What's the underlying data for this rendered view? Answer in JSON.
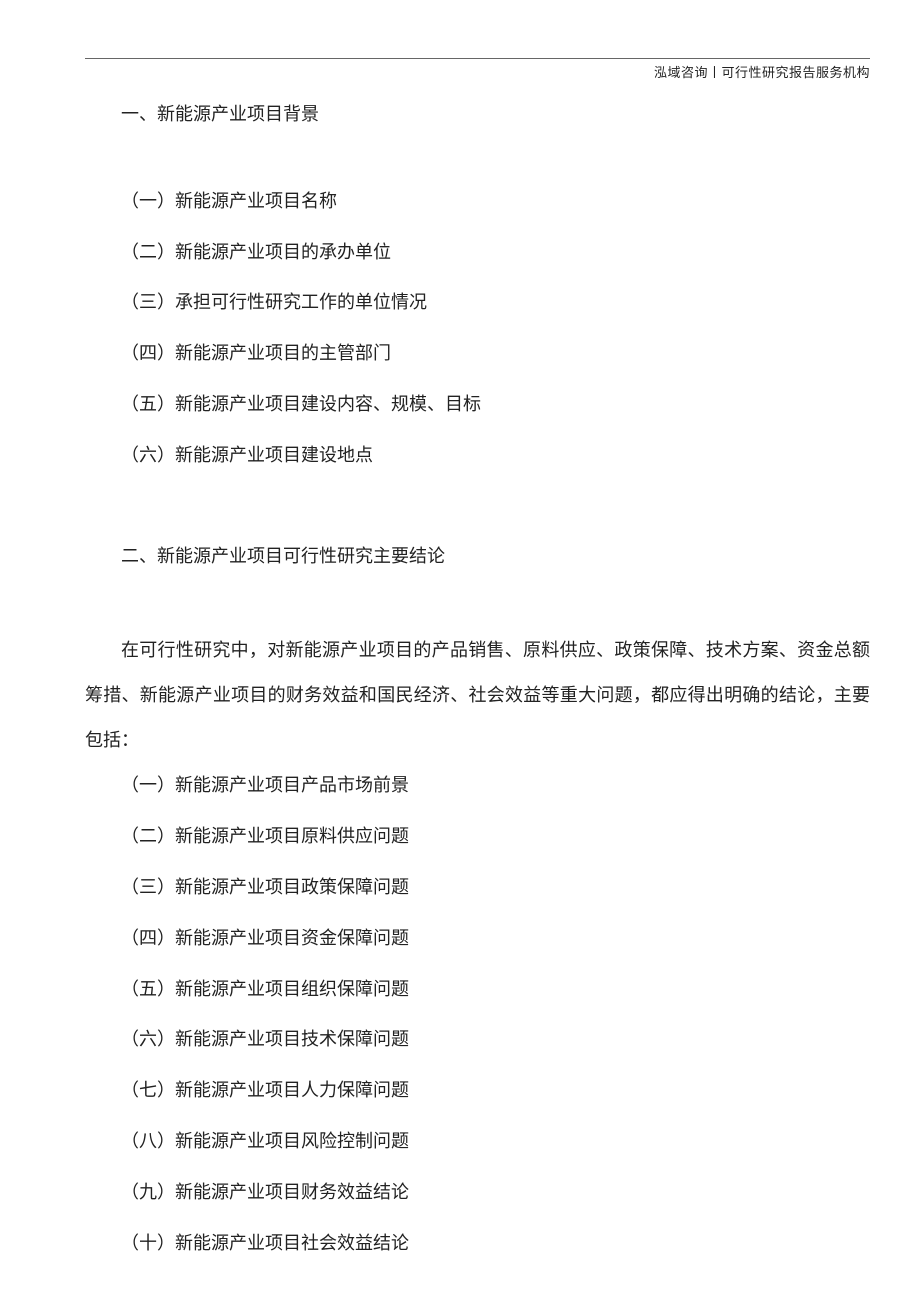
{
  "header": {
    "text": "泓域咨询丨可行性研究报告服务机构"
  },
  "section1": {
    "heading": "一、新能源产业项目背景",
    "items": [
      "（一）新能源产业项目名称",
      "（二）新能源产业项目的承办单位",
      "（三）承担可行性研究工作的单位情况",
      "（四）新能源产业项目的主管部门",
      "（五）新能源产业项目建设内容、规模、目标",
      "（六）新能源产业项目建设地点"
    ]
  },
  "section2": {
    "heading": "二、新能源产业项目可行性研究主要结论",
    "paragraph": "在可行性研究中，对新能源产业项目的产品销售、原料供应、政策保障、技术方案、资金总额筹措、新能源产业项目的财务效益和国民经济、社会效益等重大问题，都应得出明确的结论，主要包括：",
    "items": [
      "（一）新能源产业项目产品市场前景",
      "（二）新能源产业项目原料供应问题",
      "（三）新能源产业项目政策保障问题",
      "（四）新能源产业项目资金保障问题",
      "（五）新能源产业项目组织保障问题",
      "（六）新能源产业项目技术保障问题",
      "（七）新能源产业项目人力保障问题",
      "（八）新能源产业项目风险控制问题",
      "（九）新能源产业项目财务效益结论",
      "（十）新能源产业项目社会效益结论"
    ]
  }
}
